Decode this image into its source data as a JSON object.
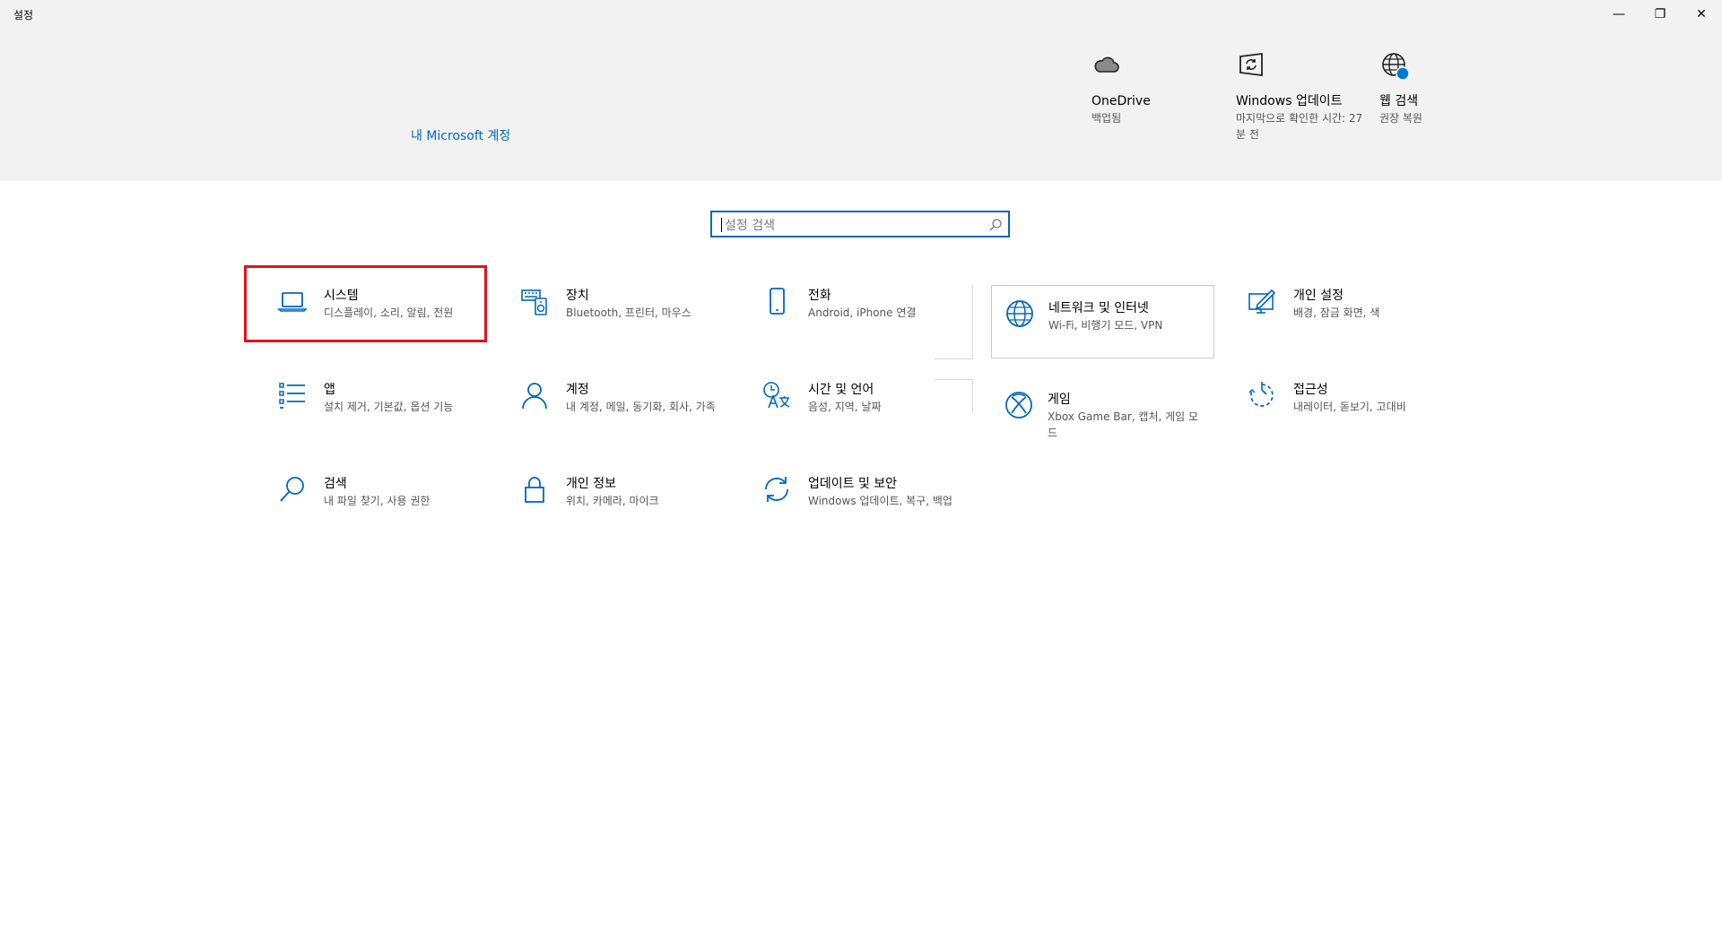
{
  "window": {
    "title": "설정",
    "minimize_glyph": "—",
    "maximize_glyph": "❐",
    "close_glyph": "✕"
  },
  "header": {
    "ms_account_link": "내 Microsoft 계정",
    "quick_links": [
      {
        "icon": "cloud-icon",
        "title": "OneDrive",
        "subtitle": "백업됨"
      },
      {
        "icon": "windows-update-icon",
        "title": "Windows 업데이트",
        "subtitle": "마지막으로 확인한 시간: 27분 전"
      },
      {
        "icon": "globe-icon",
        "title": "웹 검색",
        "subtitle": "권장 복원"
      }
    ]
  },
  "search": {
    "placeholder": "설정 검색",
    "icon": "search-icon"
  },
  "tiles": [
    {
      "icon": "laptop-icon",
      "title": "시스템",
      "desc": "디스플레이, 소리, 알림, 전원"
    },
    {
      "icon": "keyboard-speaker-icon",
      "title": "장치",
      "desc": "Bluetooth, 프린터, 마우스"
    },
    {
      "icon": "phone-icon",
      "title": "전화",
      "desc": "Android, iPhone 연결"
    },
    {
      "icon": "globe-icon",
      "title": "네트워크 및 인터넷",
      "desc": "Wi-Fi, 비행기 모드, VPN"
    },
    {
      "icon": "personalization-icon",
      "title": "개인 설정",
      "desc": "배경, 잠금 화면, 색"
    },
    {
      "icon": "apps-list-icon",
      "title": "앱",
      "desc": "설치 제거, 기본값, 옵션 기능"
    },
    {
      "icon": "person-icon",
      "title": "계정",
      "desc": "내 계정, 메일, 동기화, 회사, 가족"
    },
    {
      "icon": "time-language-icon",
      "title": "시간 및 언어",
      "desc": "음성, 지역, 날짜"
    },
    {
      "icon": "xbox-icon",
      "title": "게임",
      "desc": "Xbox Game Bar, 캡처, 게임 모드"
    },
    {
      "icon": "accessibility-timer-icon",
      "title": "접근성",
      "desc": "내레이터, 돋보기, 고대비"
    },
    {
      "icon": "search-icon",
      "title": "검색",
      "desc": "내 파일 찾기, 사용 권한"
    },
    {
      "icon": "lock-icon",
      "title": "개인 정보",
      "desc": "위치, 카메라, 마이크"
    },
    {
      "icon": "update-sync-icon",
      "title": "업데이트 및 보안",
      "desc": "Windows 업데이트, 복구, 백업"
    }
  ],
  "colors": {
    "accent": "#0067c0",
    "highlight_box": "#e0121e",
    "header_bg": "#f2f2f2"
  }
}
